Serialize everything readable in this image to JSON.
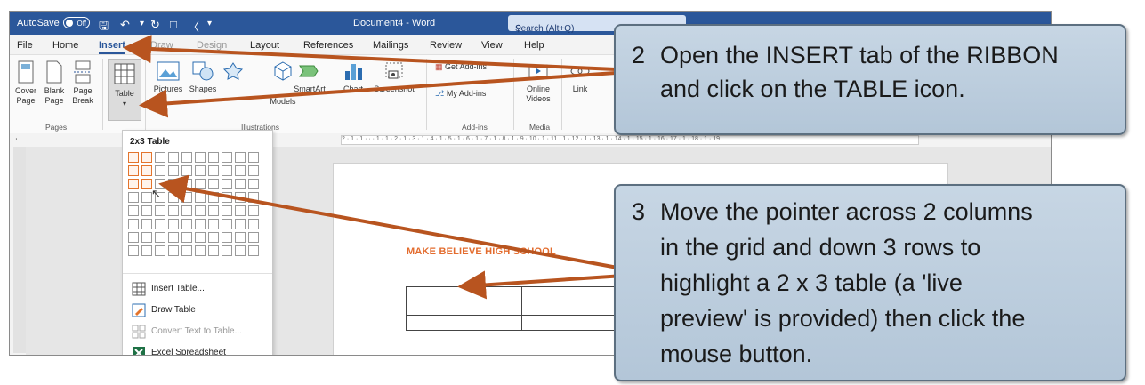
{
  "titlebar": {
    "autosave_label": "AutoSave",
    "autosave_state": "Off",
    "document_title": "Document4 - Word",
    "search_placeholder": "Search (Alt+Q)"
  },
  "menu": {
    "tabs": [
      "File",
      "Home",
      "Insert",
      "Draw",
      "Design",
      "Layout",
      "References",
      "Mailings",
      "Review",
      "View",
      "Help"
    ],
    "active_tab": "Insert"
  },
  "ribbon": {
    "pages": {
      "cover_page": "Cover Page",
      "blank_page": "Blank Page",
      "page_break": "Page Break",
      "group": "Pages"
    },
    "tables": {
      "table": "Table"
    },
    "illustrations": {
      "pictures": "Pictures",
      "shapes": "Shapes",
      "models": "Models",
      "smartart": "SmartArt",
      "chart": "Chart",
      "screenshot": "Screenshot",
      "group": "Illustrations"
    },
    "addins": {
      "get_addins": "Get Add-ins",
      "my_addins": "My Add-ins",
      "group": "Add-ins"
    },
    "media": {
      "online_videos": "Online Videos",
      "group": "Media"
    },
    "links": {
      "link": "Link"
    }
  },
  "ruler_text": "2 · 1 · 1 · · · 1 · 1 · 2 · 1 · 3 · 1 · 4 · 1 · 5 · 1 · 6 · 1 · 7 · 1 · 8 · 1 · 9 · 10 · 1 · 11 · 1 · 12 · 1 · 13 · 1 · 14 · 1 · 15 · 1 · 16 · 17 · 1 · 18 · 1 · 19",
  "table_dropdown": {
    "header": "2x3 Table",
    "grid_columns": 10,
    "grid_rows": 8,
    "highlighted_columns": 2,
    "highlighted_rows": 3,
    "items": [
      {
        "label": "Insert Table...",
        "enabled": true,
        "icon": "table-grid-icon"
      },
      {
        "label": "Draw Table",
        "enabled": true,
        "icon": "pencil-table-icon"
      },
      {
        "label": "Convert Text to Table...",
        "enabled": false,
        "icon": "convert-table-icon"
      },
      {
        "label": "Excel Spreadsheet",
        "enabled": true,
        "icon": "excel-icon"
      }
    ]
  },
  "document": {
    "heading": "MAKE BELIEVE HIGH SCHOOL"
  },
  "callouts": [
    {
      "number": "2",
      "lines": [
        "Open the INSERT tab of the RIBBON",
        "and click on the TABLE icon."
      ]
    },
    {
      "number": "3",
      "lines": [
        "Move the pointer across 2 columns",
        "in the grid and down 3 rows to",
        "highlight a 2 x 3 table (a 'live",
        "preview' is provided) then click the",
        "mouse button."
      ]
    }
  ],
  "colors": {
    "word_blue": "#2b579a",
    "arrow": "#b8541f",
    "callout_fill": "#bccddd",
    "heading_orange": "#e36c2e"
  }
}
